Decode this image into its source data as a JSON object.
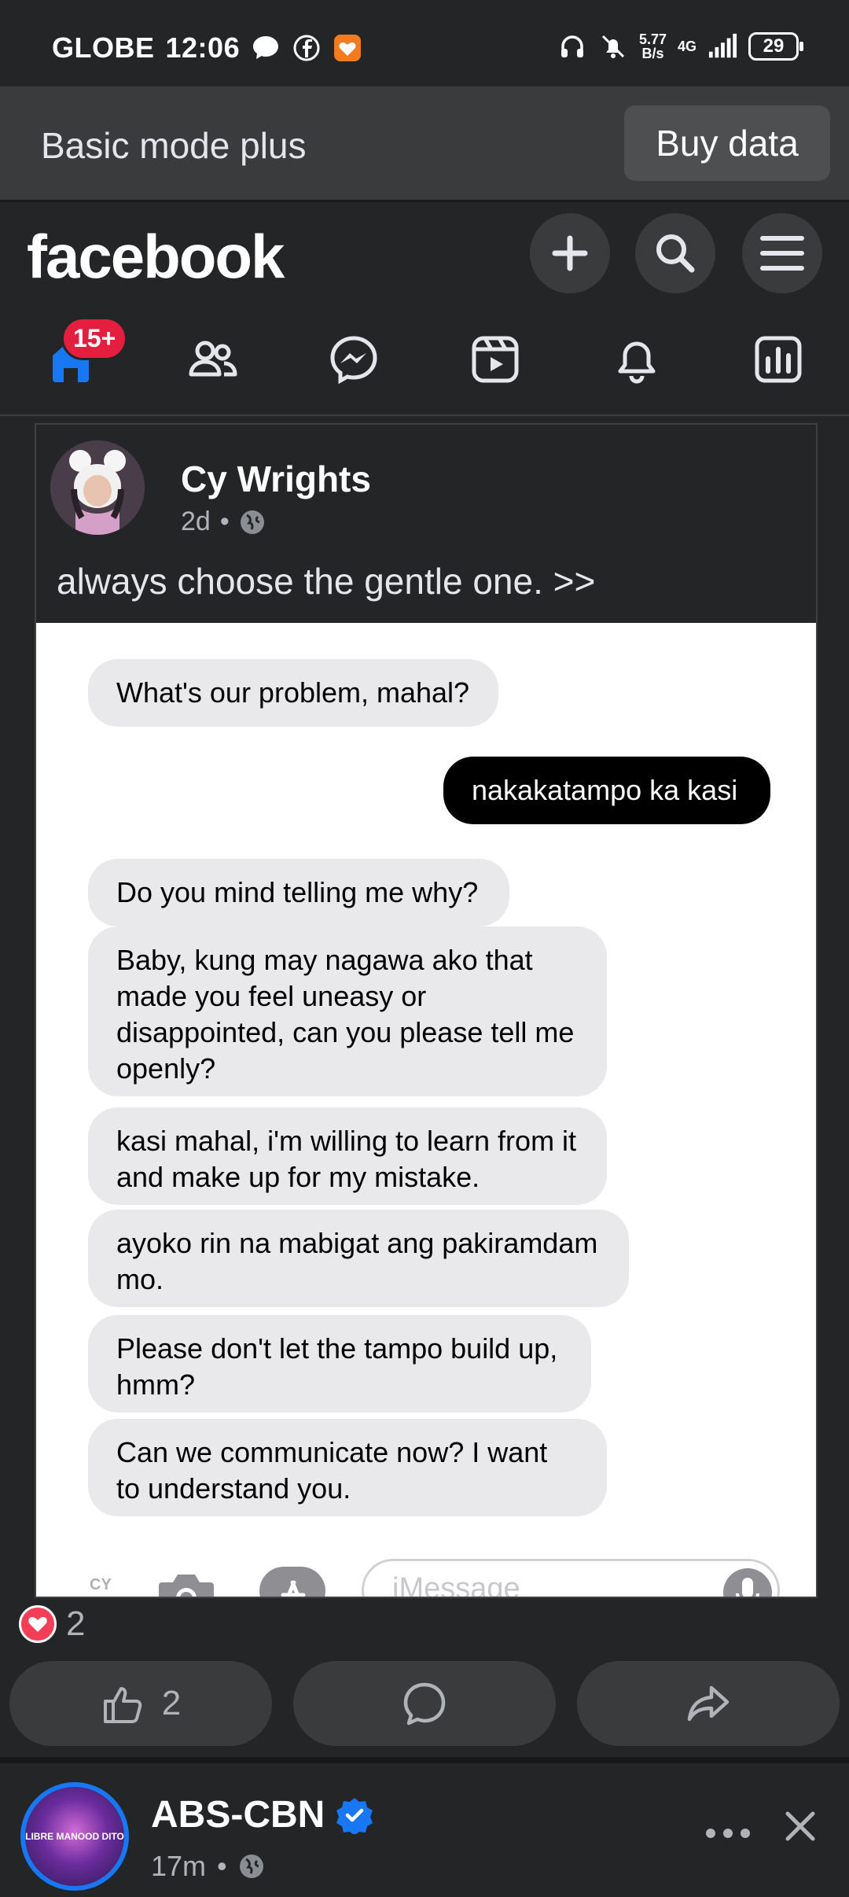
{
  "status_bar": {
    "carrier": "GLOBE",
    "time": "12:06",
    "net_speed_value": "5.77",
    "net_speed_unit": "B/s",
    "network": "4G",
    "battery": "29"
  },
  "banner": {
    "text": "Basic mode plus",
    "button": "Buy data"
  },
  "header": {
    "logo": "facebook",
    "nav_badge": "15+"
  },
  "post": {
    "author": "Cy Wrights",
    "time": "2d",
    "caption": "always choose the gentle one. >>",
    "messages": [
      {
        "from": "them",
        "text": "What's our problem, mahal?"
      },
      {
        "from": "me",
        "text": "nakakatampo ka kasi"
      },
      {
        "from": "them",
        "text": "Do you mind telling me why?"
      },
      {
        "from": "them",
        "text": "Baby, kung may nagawa ako that made you feel uneasy or disappointed, can you please tell me openly?"
      },
      {
        "from": "them",
        "text": "kasi mahal, i'm willing to learn from it and make up for my mistake."
      },
      {
        "from": "them",
        "text": "ayoko rin na mabigat ang pakiramdam mo."
      },
      {
        "from": "them",
        "text": "Please don't let the tampo build up, hmm?"
      },
      {
        "from": "them",
        "text": "Can we communicate now? I want to understand you."
      }
    ],
    "imessage_placeholder": "iMessage",
    "watermark": "CY",
    "reaction_count": "2",
    "like_count": "2"
  },
  "next_post": {
    "author": "ABS-CBN",
    "time": "17m",
    "avatar_text": "LIBRE MANOOD DITO"
  },
  "colors": {
    "background": "#242526",
    "banner": "#3a3b3c",
    "accent": "#1877f2",
    "badge": "#e41e3f",
    "love": "#f33e58"
  }
}
